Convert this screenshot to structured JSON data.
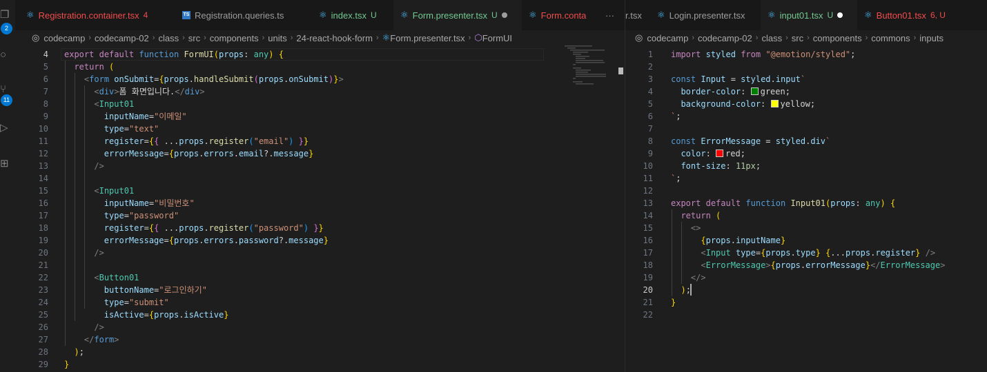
{
  "activity_bar": {
    "scm_badge": "2",
    "extensions_badge": "11"
  },
  "left_editor": {
    "tabs": [
      {
        "label": "Registration.container.tsx",
        "status": "4",
        "icon": "react-icon",
        "color": "#f14c4c",
        "active": false
      },
      {
        "label": "Registration.queries.ts",
        "status": "",
        "icon": "ts-icon",
        "color": "#9d9d9d",
        "active": false
      },
      {
        "label": "index.tsx",
        "status": "U",
        "icon": "react-icon",
        "color": "#73c991",
        "active": false
      },
      {
        "label": "Form.presenter.tsx",
        "status": "U",
        "icon": "react-icon",
        "color": "#73c991",
        "active": true,
        "dirty": true
      },
      {
        "label": "Form.conta",
        "status": "",
        "icon": "react-icon",
        "color": "#f14c4c",
        "active": false
      }
    ],
    "more_label": "···",
    "breadcrumb": [
      "codecamp",
      "codecamp-02",
      "class",
      "src",
      "components",
      "units",
      "24-react-hook-form",
      "Form.presenter.tsx",
      "FormUI"
    ],
    "lines": [
      {
        "n": "4",
        "t": "export default function FormUI(props: any) {"
      },
      {
        "n": "5",
        "t": "  return ("
      },
      {
        "n": "6",
        "t": "    <form onSubmit={props.handleSubmit(props.onSubmit)}>"
      },
      {
        "n": "7",
        "t": "      <div>폼 화면입니다.</div>"
      },
      {
        "n": "8",
        "t": "      <Input01"
      },
      {
        "n": "9",
        "t": "        inputName=\"이메일\""
      },
      {
        "n": "10",
        "t": "        type=\"text\""
      },
      {
        "n": "11",
        "t": "        register={{ ...props.register(\"email\") }}"
      },
      {
        "n": "12",
        "t": "        errorMessage={props.errors.email?.message}"
      },
      {
        "n": "13",
        "t": "      />"
      },
      {
        "n": "14",
        "t": ""
      },
      {
        "n": "15",
        "t": "      <Input01"
      },
      {
        "n": "16",
        "t": "        inputName=\"비밀번호\""
      },
      {
        "n": "17",
        "t": "        type=\"password\""
      },
      {
        "n": "18",
        "t": "        register={{ ...props.register(\"password\") }}"
      },
      {
        "n": "19",
        "t": "        errorMessage={props.errors.password?.message}"
      },
      {
        "n": "20",
        "t": "      />"
      },
      {
        "n": "21",
        "t": ""
      },
      {
        "n": "22",
        "t": "      <Button01"
      },
      {
        "n": "23",
        "t": "        buttonName=\"로그인하기\""
      },
      {
        "n": "24",
        "t": "        type=\"submit\""
      },
      {
        "n": "25",
        "t": "        isActive={props.isActive}"
      },
      {
        "n": "26",
        "t": "      />"
      },
      {
        "n": "27",
        "t": "    </form>"
      },
      {
        "n": "28",
        "t": "  );"
      },
      {
        "n": "29",
        "t": "}"
      }
    ]
  },
  "right_editor": {
    "tabs": [
      {
        "label": "r.tsx",
        "status": "",
        "icon": "",
        "color": "#9d9d9d",
        "active": false
      },
      {
        "label": "Login.presenter.tsx",
        "status": "",
        "icon": "react-icon",
        "color": "#9d9d9d",
        "active": false
      },
      {
        "label": "input01.tsx",
        "status": "U",
        "icon": "react-icon",
        "color": "#73c991",
        "active": true,
        "dirty": true
      },
      {
        "label": "Button01.tsx",
        "status": "6, U",
        "icon": "react-icon",
        "color": "#f14c4c",
        "active": false
      }
    ],
    "breadcrumb": [
      "codecamp",
      "codecamp-02",
      "class",
      "src",
      "components",
      "commons",
      "inputs"
    ],
    "lines": [
      {
        "n": "1",
        "t": "import styled from \"@emotion/styled\";"
      },
      {
        "n": "2",
        "t": ""
      },
      {
        "n": "3",
        "t": "const Input = styled.input`"
      },
      {
        "n": "4",
        "t": "  border-color: green;"
      },
      {
        "n": "5",
        "t": "  background-color: yellow;"
      },
      {
        "n": "6",
        "t": "`;"
      },
      {
        "n": "7",
        "t": ""
      },
      {
        "n": "8",
        "t": "const ErrorMessage = styled.div`"
      },
      {
        "n": "9",
        "t": "  color: red;"
      },
      {
        "n": "10",
        "t": "  font-size: 11px;"
      },
      {
        "n": "11",
        "t": "`;"
      },
      {
        "n": "12",
        "t": ""
      },
      {
        "n": "13",
        "t": "export default function Input01(props: any) {"
      },
      {
        "n": "14",
        "t": "  return ("
      },
      {
        "n": "15",
        "t": "    <>"
      },
      {
        "n": "16",
        "t": "      {props.inputName}"
      },
      {
        "n": "17",
        "t": "      <Input type={props.type} {...props.register} />"
      },
      {
        "n": "18",
        "t": "      <ErrorMessage>{props.errorMessage}</ErrorMessage>"
      },
      {
        "n": "19",
        "t": "    </>"
      },
      {
        "n": "20",
        "t": "  );"
      },
      {
        "n": "21",
        "t": "}"
      },
      {
        "n": "22",
        "t": ""
      }
    ]
  },
  "colors": {
    "green_swatch": "#008000",
    "yellow_swatch": "#ffff00",
    "red_swatch": "#ff0000"
  }
}
